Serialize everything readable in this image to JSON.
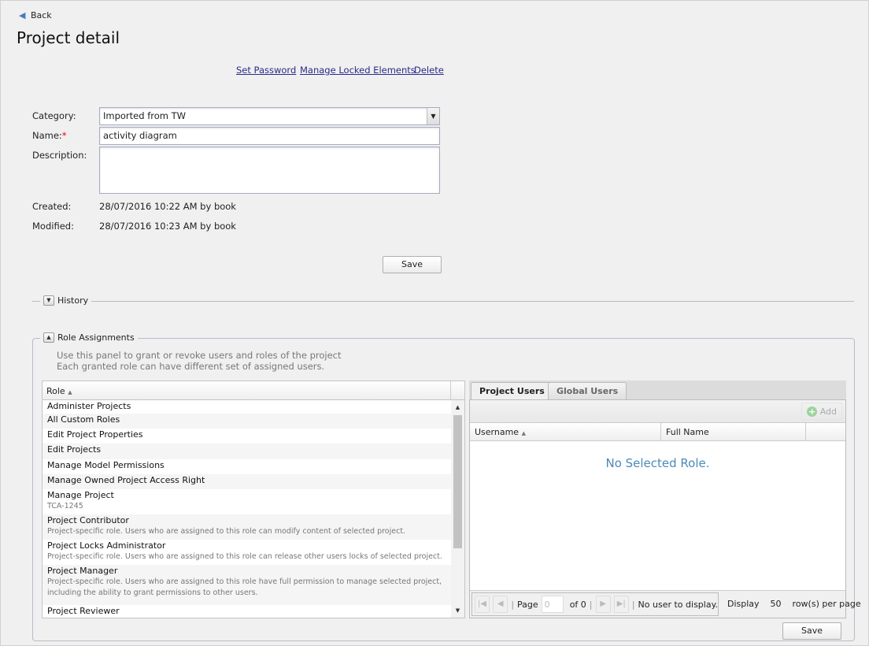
{
  "nav": {
    "back": "Back"
  },
  "page": {
    "title": "Project detail"
  },
  "actions": {
    "set_password": "Set Password",
    "manage_locked": "Manage Locked Elements",
    "delete": "Delete"
  },
  "form": {
    "category_label": "Category:",
    "category_value": "Imported from TW",
    "name_label": "Name:",
    "required_mark": "*",
    "name_value": "activity diagram",
    "description_label": "Description:",
    "description_value": "",
    "created_label": "Created:",
    "created_value": "28/07/2016 10:22 AM by book",
    "modified_label": "Modified:",
    "modified_value": "28/07/2016 10:23 AM by book",
    "save": "Save"
  },
  "history": {
    "title": "History"
  },
  "roles": {
    "title": "Role Assignments",
    "help1": "Use this panel to grant or revoke users and roles of the project",
    "help2": "Each granted role can have different set of assigned users.",
    "column": "Role",
    "items": [
      {
        "name": "Administer Projects",
        "desc": ""
      },
      {
        "name": "All Custom Roles",
        "desc": ""
      },
      {
        "name": "Edit Project Properties",
        "desc": ""
      },
      {
        "name": "Edit Projects",
        "desc": ""
      },
      {
        "name": "Manage Model Permissions",
        "desc": ""
      },
      {
        "name": "Manage Owned Project Access Right",
        "desc": ""
      },
      {
        "name": "Manage Project",
        "desc": "TCA-1245"
      },
      {
        "name": "Project Contributor",
        "desc": "Project-specific role. Users who are assigned to this role can modify content of selected project."
      },
      {
        "name": "Project Locks Administrator",
        "desc": "Project-specific role. Users who are assigned to this role can release other users locks of selected project."
      },
      {
        "name": "Project Manager",
        "desc": "Project-specific role. Users who are assigned to this role have full permission to manage selected project, including the ability to grant permissions to other users."
      },
      {
        "name": "Project Reviewer",
        "desc": ""
      }
    ],
    "save": "Save"
  },
  "users": {
    "tabs": [
      "Project Users",
      "Global Users"
    ],
    "add": "Add",
    "columns": [
      "Username",
      "Full Name"
    ],
    "empty": "No Selected Role.",
    "paging": {
      "page_label": "Page",
      "page_value": "0",
      "of": "of 0",
      "status": "No user to display.",
      "display": "Display",
      "per_page": "50",
      "rows_label": "row(s) per page"
    }
  }
}
